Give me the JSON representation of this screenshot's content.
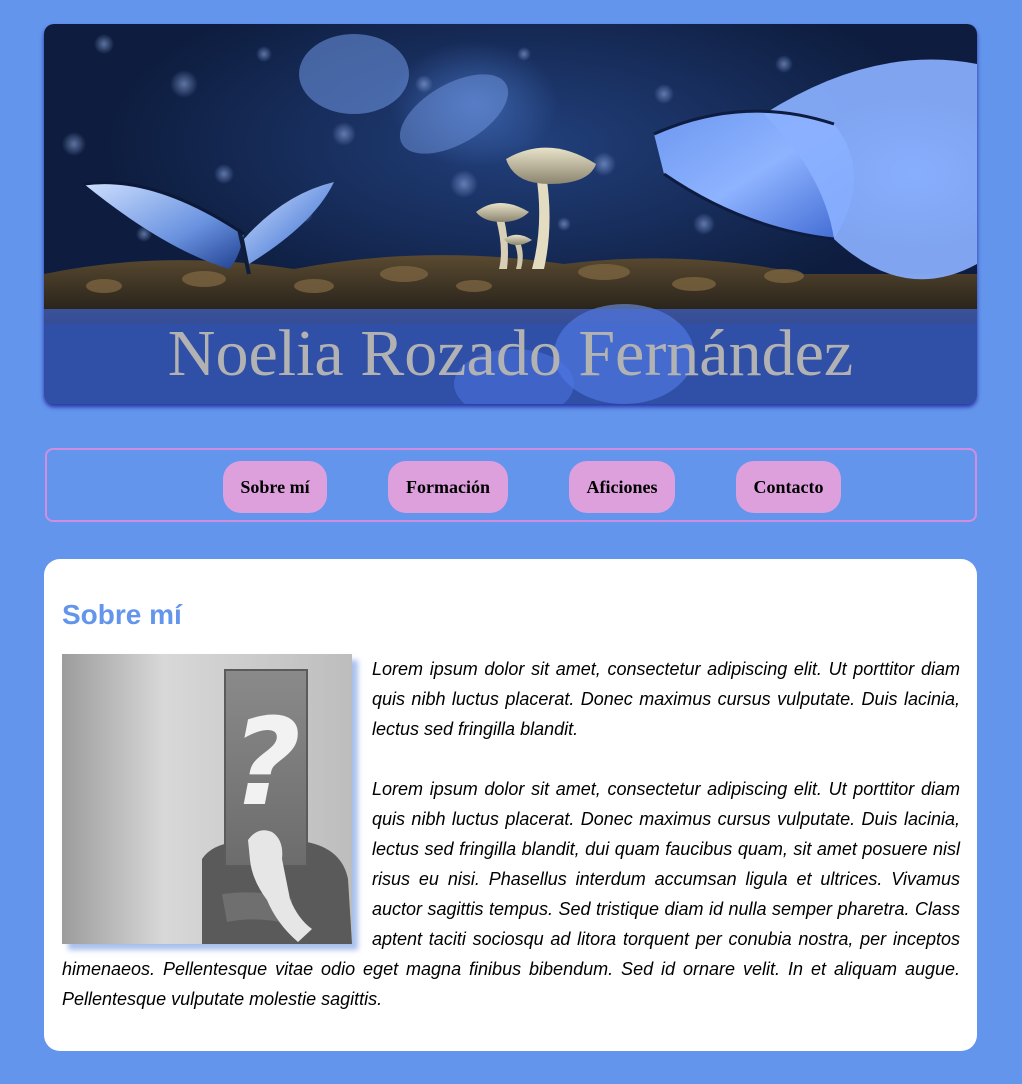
{
  "header": {
    "site_name": "Noelia Rozado Fernández"
  },
  "nav": {
    "items": [
      {
        "label": "Sobre mí"
      },
      {
        "label": "Formación"
      },
      {
        "label": "Aficiones"
      },
      {
        "label": "Contacto"
      }
    ]
  },
  "main": {
    "title": "Sobre mí",
    "paragraphs": [
      "Lorem ipsum dolor sit amet, consectetur adipiscing elit. Ut porttitor diam quis nibh luctus placerat. Donec maximus cursus vulputate. Duis lacinia, lectus sed fringilla blandit.",
      "Lorem ipsum dolor sit amet, consectetur adipiscing elit. Ut porttitor diam quis nibh luctus placerat. Donec maximus cursus vulputate. Duis lacinia, lectus sed fringilla blandit, dui quam faucibus quam, sit amet posuere nisl risus eu nisi. Phasellus interdum accumsan ligula et ultrices. Vivamus auctor sagittis tempus. Sed tristique diam id nulla semper pharetra. Class aptent taciti sociosqu ad litora torquent per conubia nostra, per inceptos himenaeos. Pellentesque vitae odio eget magna finibus bibendum. Sed id ornare velit. In et aliquam augue. Pellentesque vulputate molestie sagittis."
    ],
    "photo_symbol": "?"
  },
  "colors": {
    "page_background": "#6495ED",
    "nav_button": "#DDA0DD",
    "nav_border": "#D08EE0",
    "title": "#6495ED",
    "card": "#FFFFFF"
  }
}
